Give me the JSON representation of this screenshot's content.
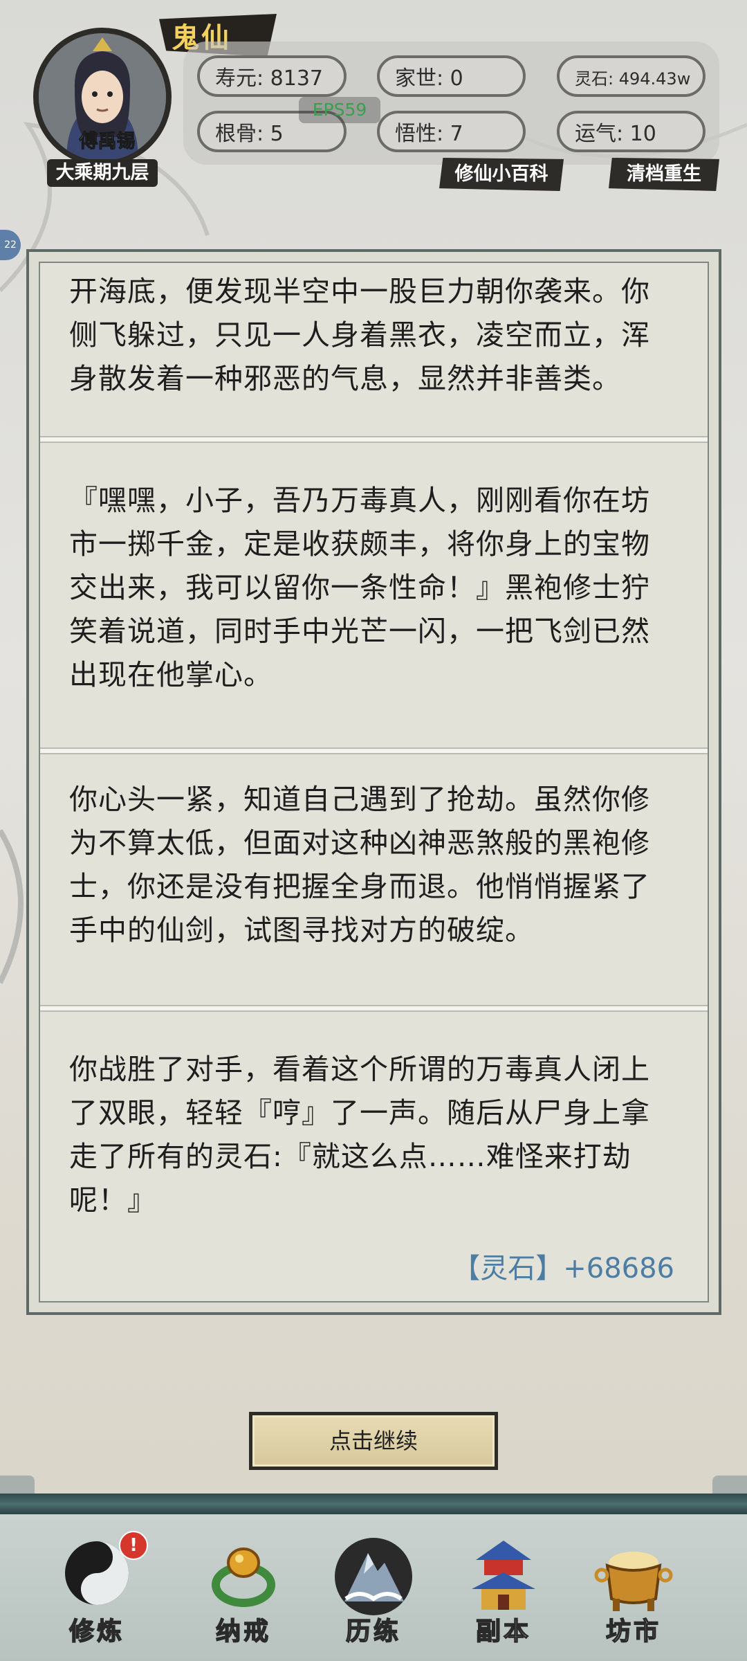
{
  "header": {
    "title": "鬼仙",
    "character_name": "傅禹锡",
    "realm": "大乘期九层",
    "fps": "EPS59",
    "stats": [
      {
        "label": "寿元: 8137"
      },
      {
        "label": "家世: 0"
      },
      {
        "label": "灵石: 494.43w"
      },
      {
        "label": "根骨: 5"
      },
      {
        "label": "悟性: 7"
      },
      {
        "label": "运气: 10"
      }
    ],
    "links": {
      "encyclopedia": "修仙小百科",
      "reset": "清档重生"
    },
    "side_tab": "22"
  },
  "story": {
    "paragraphs": [
      "开海底，便发现半空中一股巨力朝你袭来。你侧飞躲过，只见一人身着黑衣，凌空而立，浑身散发着一种邪恶的气息，显然并非善类。",
      "『嘿嘿，小子，吾乃万毒真人，刚刚看你在坊市一掷千金，定是收获颇丰，将你身上的宝物交出来，我可以留你一条性命！』黑袍修士狞笑着说道，同时手中光芒一闪，一把飞剑已然出现在他掌心。",
      "你心头一紧，知道自己遇到了抢劫。虽然你修为不算太低，但面对这种凶神恶煞般的黑袍修士，你还是没有把握全身而退。他悄悄握紧了手中的仙剑，试图寻找对方的破绽。",
      "你战胜了对手，看着这个所谓的万毒真人闭上了双眼，轻轻『哼』了一声。随后从尸身上拿走了所有的灵石:『就这么点……难怪来打劫呢！』"
    ],
    "reward": "【灵石】+68686"
  },
  "continue_label": "点击继续",
  "nav": {
    "items": [
      {
        "label": "修炼",
        "icon": "yin-yang-icon",
        "alert": "!"
      },
      {
        "label": "纳戒",
        "icon": "ring-icon"
      },
      {
        "label": "历练",
        "icon": "mountain-icon"
      },
      {
        "label": "副本",
        "icon": "pagoda-icon"
      },
      {
        "label": "坊市",
        "icon": "treasure-cauldron-icon"
      }
    ]
  },
  "colors": {
    "title_gold": "#f4d060",
    "reward_blue": "#4d7da3",
    "alert_red": "#d5372d",
    "panel_bg": "#e3e2d8"
  }
}
